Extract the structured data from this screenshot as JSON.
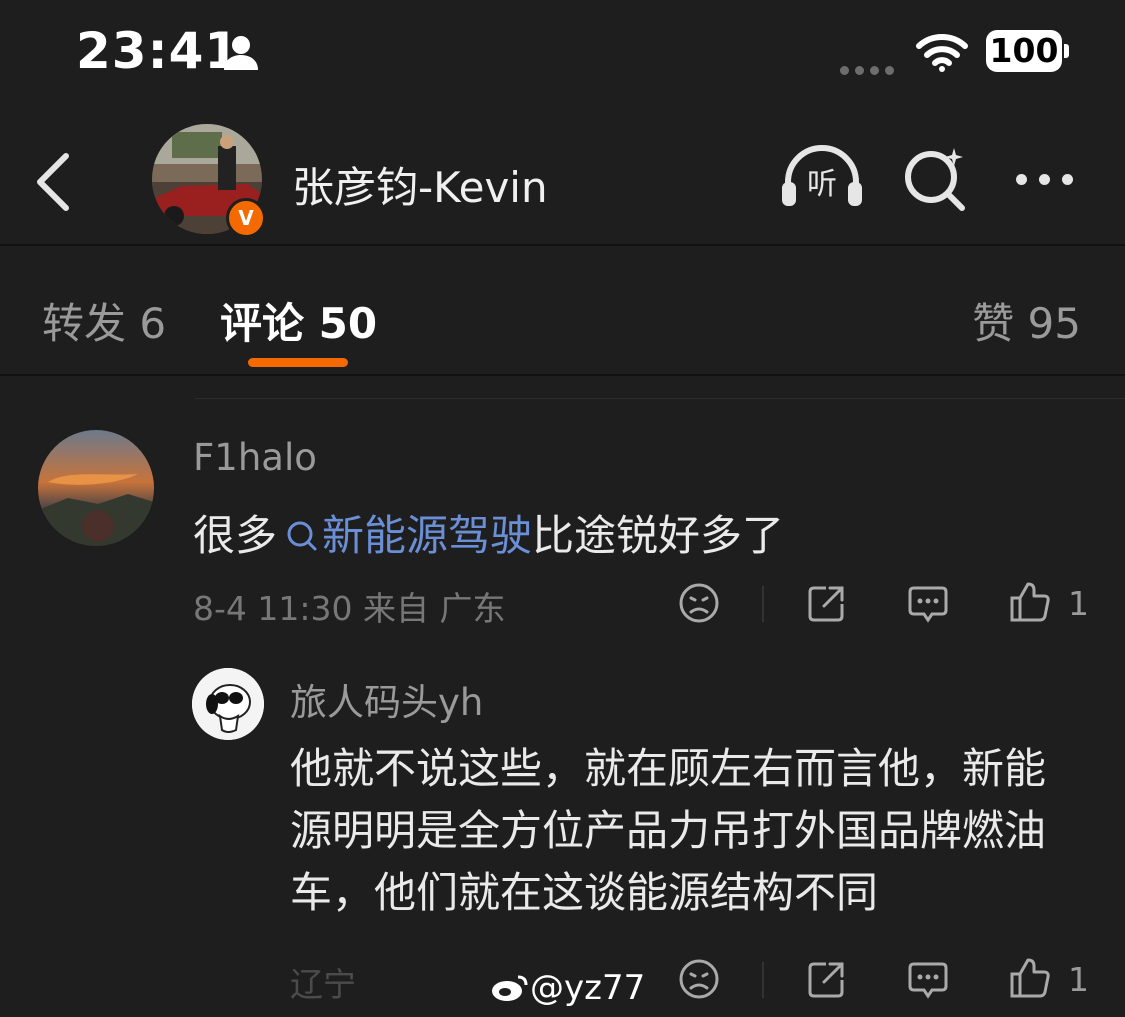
{
  "status_bar": {
    "time": "23:41",
    "battery": "100"
  },
  "header": {
    "username": "张彦钧-Kevin",
    "listen_label": "听",
    "verified_badge": "V"
  },
  "tabs": [
    {
      "label": "转发 6"
    },
    {
      "label": "评论 50"
    },
    {
      "label": "赞 95"
    }
  ],
  "comments": [
    {
      "user": "F1halo",
      "text_before": "很多",
      "topic": "新能源驾驶",
      "text_after": "比途锐好多了",
      "meta": "8-4 11:30  来自 广东",
      "likes": "1",
      "reply": {
        "user": "旅人码头yh",
        "text": "他就不说这些，就在顾左右而言他，新能源明明是全方位产品力吊打外国品牌燃油车，他们就在这谈能源结构不同",
        "meta": "辽宁",
        "likes": "1"
      }
    }
  ],
  "watermark": "@yz77",
  "colors": {
    "accent": "#f56a00",
    "topic": "#6b8fd6",
    "background": "#1e1e1e"
  }
}
